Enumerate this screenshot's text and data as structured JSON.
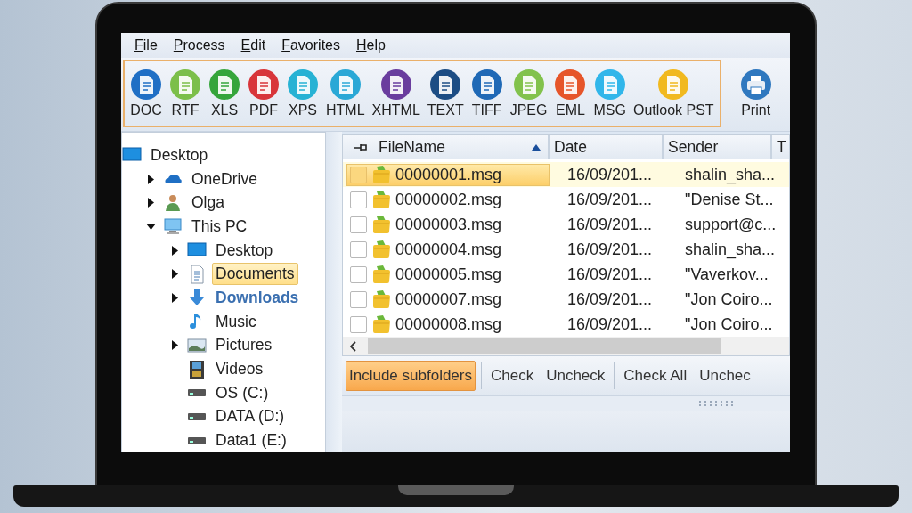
{
  "menu": [
    {
      "label": "File"
    },
    {
      "label": "Process"
    },
    {
      "label": "Edit"
    },
    {
      "label": "Favorites"
    },
    {
      "label": "Help"
    }
  ],
  "toolbar": {
    "formats": [
      {
        "label": "DOC",
        "color": "#1f6fc5"
      },
      {
        "label": "RTF",
        "color": "#7cbf4a"
      },
      {
        "label": "XLS",
        "color": "#35a53b"
      },
      {
        "label": "PDF",
        "color": "#d8353a"
      },
      {
        "label": "XPS",
        "color": "#27b2d4"
      },
      {
        "label": "HTML",
        "color": "#2aa8d6"
      },
      {
        "label": "XHTML",
        "color": "#6a3d9e"
      },
      {
        "label": "TEXT",
        "color": "#1c4d84"
      },
      {
        "label": "TIFF",
        "color": "#1f69b6"
      },
      {
        "label": "JPEG",
        "color": "#82c24c"
      },
      {
        "label": "EML",
        "color": "#e6552a"
      },
      {
        "label": "MSG",
        "color": "#31b6ea"
      },
      {
        "label": "Outlook PST",
        "color": "#f1b91f"
      }
    ],
    "print": {
      "label": "Print"
    }
  },
  "tree": [
    {
      "label": "Desktop",
      "kind": "desktop",
      "has_children": false,
      "selected": false,
      "emphasized": false,
      "children": [
        {
          "label": "OneDrive",
          "kind": "cloud",
          "has_children": true,
          "expanded": false,
          "selected": false,
          "emphasized": false
        },
        {
          "label": "Olga",
          "kind": "user",
          "has_children": true,
          "expanded": false,
          "selected": false,
          "emphasized": false
        },
        {
          "label": "This PC",
          "kind": "computer",
          "has_children": true,
          "expanded": true,
          "selected": false,
          "emphasized": false,
          "children": [
            {
              "label": "Desktop",
              "kind": "desktop",
              "has_children": true,
              "expanded": false,
              "selected": false,
              "emphasized": false
            },
            {
              "label": "Documents",
              "kind": "document",
              "has_children": true,
              "expanded": false,
              "selected": true,
              "emphasized": false
            },
            {
              "label": "Downloads",
              "kind": "download",
              "has_children": true,
              "expanded": false,
              "selected": false,
              "emphasized": true
            },
            {
              "label": "Music",
              "kind": "music",
              "has_children": false,
              "selected": false,
              "emphasized": false
            },
            {
              "label": "Pictures",
              "kind": "pictures",
              "has_children": true,
              "expanded": false,
              "selected": false,
              "emphasized": false
            },
            {
              "label": "Videos",
              "kind": "videos",
              "has_children": false,
              "selected": false,
              "emphasized": false
            },
            {
              "label": "OS (C:)",
              "kind": "drive",
              "has_children": false,
              "selected": false,
              "emphasized": false
            },
            {
              "label": "DATA (D:)",
              "kind": "drive",
              "has_children": false,
              "selected": false,
              "emphasized": false
            },
            {
              "label": "Data1 (E:)",
              "kind": "drive",
              "has_children": false,
              "selected": false,
              "emphasized": false
            }
          ]
        }
      ]
    }
  ],
  "file_list": {
    "columns": [
      {
        "label": "FileName",
        "sorted": true
      },
      {
        "label": "Date",
        "sorted": false
      },
      {
        "label": "Sender",
        "sorted": false
      },
      {
        "label": "T",
        "sorted": false
      }
    ],
    "rows": [
      {
        "selected": true,
        "checked": false,
        "file_name": "00000001.msg",
        "date": "16/09/201...",
        "sender": "shalin_sha..."
      },
      {
        "selected": false,
        "checked": false,
        "file_name": "00000002.msg",
        "date": "16/09/201...",
        "sender": "\"Denise St..."
      },
      {
        "selected": false,
        "checked": false,
        "file_name": "00000003.msg",
        "date": "16/09/201...",
        "sender": "support@c..."
      },
      {
        "selected": false,
        "checked": false,
        "file_name": "00000004.msg",
        "date": "16/09/201...",
        "sender": "shalin_sha..."
      },
      {
        "selected": false,
        "checked": false,
        "file_name": "00000005.msg",
        "date": "16/09/201...",
        "sender": "\"Vaverkov..."
      },
      {
        "selected": false,
        "checked": false,
        "file_name": "00000007.msg",
        "date": "16/09/201...",
        "sender": "\"Jon Coiro..."
      },
      {
        "selected": false,
        "checked": false,
        "file_name": "00000008.msg",
        "date": "16/09/201...",
        "sender": "\"Jon Coiro..."
      }
    ]
  },
  "actions": {
    "include_subfolders": {
      "label": "Include subfolders",
      "on": true
    },
    "groups": [
      [
        "Check",
        "Uncheck"
      ],
      [
        "Check All",
        "Unchec"
      ]
    ]
  }
}
